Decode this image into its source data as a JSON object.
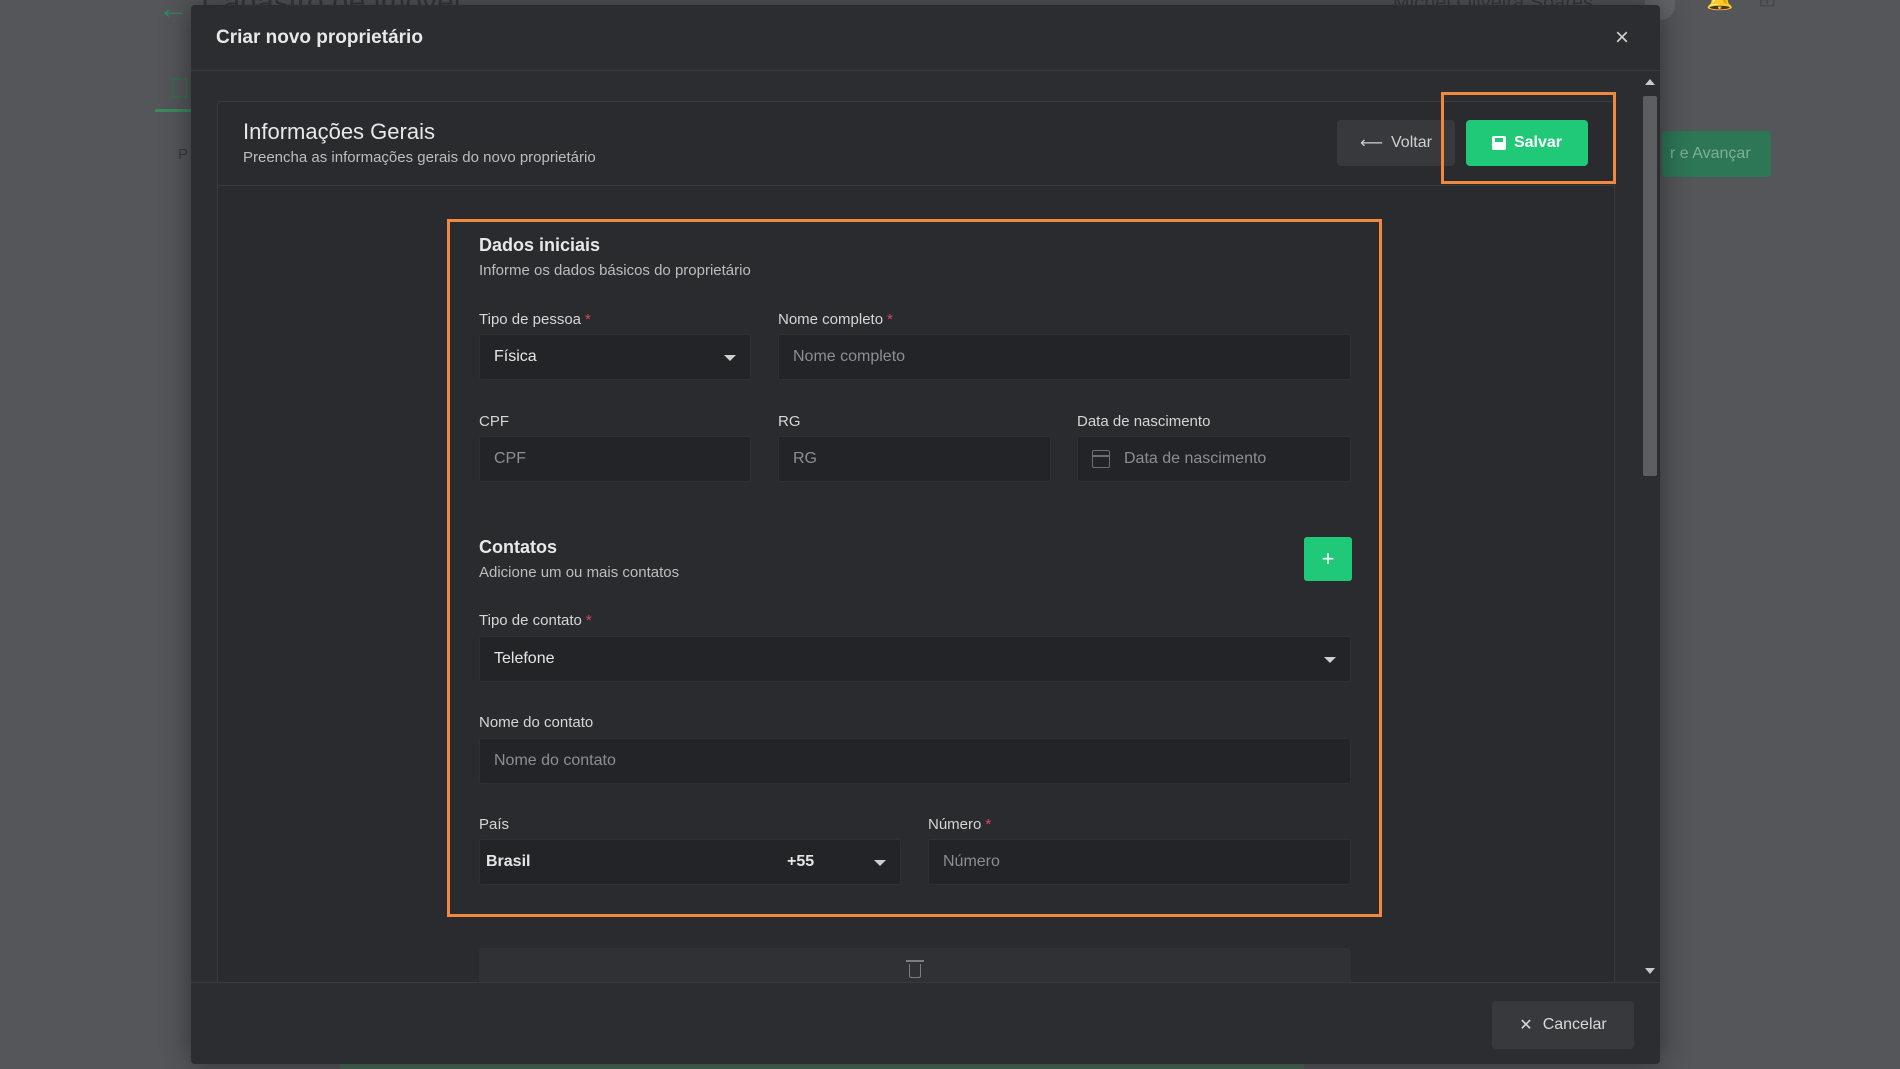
{
  "background": {
    "title": "Cadastro de imóvel",
    "user_name": "Michel Oliveira Soares",
    "advance_button": "r e Avançar",
    "partial_letter": "P"
  },
  "modal": {
    "title": "Criar novo proprietário",
    "close_icon": "×"
  },
  "panel": {
    "title": "Informações Gerais",
    "subtitle": "Preencha as informações gerais do novo proprietário",
    "back_button": "Voltar",
    "back_icon": "⟵",
    "save_button": "Salvar",
    "save_icon": "💾"
  },
  "dados_iniciais": {
    "title": "Dados iniciais",
    "subtitle": "Informe os dados básicos do proprietário",
    "tipo_pessoa": {
      "label": "Tipo de pessoa",
      "required": "*",
      "value": "Física"
    },
    "nome_completo": {
      "label": "Nome completo",
      "required": "*",
      "placeholder": "Nome completo"
    },
    "cpf": {
      "label": "CPF",
      "placeholder": "CPF"
    },
    "rg": {
      "label": "RG",
      "placeholder": "RG"
    },
    "data_nascimento": {
      "label": "Data de nascimento",
      "placeholder": "Data de nascimento"
    }
  },
  "contatos": {
    "title": "Contatos",
    "subtitle": "Adicione um ou mais contatos",
    "add_button": "+",
    "tipo_contato": {
      "label": "Tipo de contato",
      "required": "*",
      "value": "Telefone"
    },
    "nome_contato": {
      "label": "Nome do contato",
      "placeholder": "Nome do contato"
    },
    "pais": {
      "label": "País",
      "value": "Brasil",
      "code": "+55"
    },
    "numero": {
      "label": "Número",
      "required": "*",
      "placeholder": "Número"
    }
  },
  "footer": {
    "cancel_button": "Cancelar",
    "cancel_icon": "✕"
  },
  "colors": {
    "accent": "#1fc978",
    "highlight": "#f0883e",
    "required": "#e0445a",
    "modal_bg": "#2c2d30"
  }
}
